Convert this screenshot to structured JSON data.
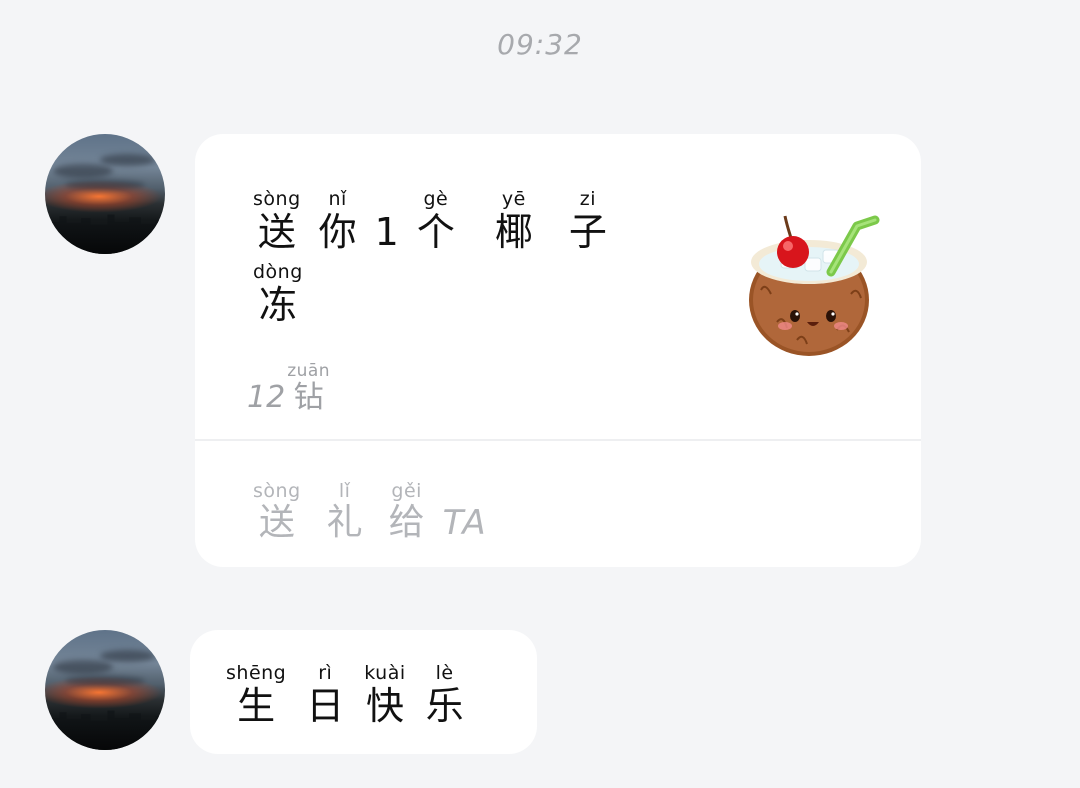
{
  "timestamp": "09:32",
  "messages": [
    {
      "type": "gift",
      "avatar_icon": "sunset-city-avatar",
      "gift_text_line1": [
        {
          "pinyin": "sòng",
          "hanzi": "送"
        },
        {
          "pinyin": "nǐ",
          "hanzi": "你"
        },
        {
          "pinyin": "",
          "hanzi": "1"
        },
        {
          "pinyin": "gè",
          "hanzi": "个"
        },
        {
          "pinyin": "yē",
          "hanzi": "椰"
        },
        {
          "pinyin": "zi",
          "hanzi": "子"
        }
      ],
      "gift_text_line2": [
        {
          "pinyin": "dòng",
          "hanzi": "冻"
        }
      ],
      "price": {
        "amount": "12",
        "unit_pinyin": "zuān",
        "unit_hanzi": "钻"
      },
      "gift_icon": "coconut-drink-icon",
      "send_action": {
        "words": [
          {
            "pinyin": "sòng",
            "hanzi": "送"
          },
          {
            "pinyin": "lǐ",
            "hanzi": "礼"
          },
          {
            "pinyin": "gěi",
            "hanzi": "给"
          }
        ],
        "suffix": "TA"
      }
    },
    {
      "type": "text",
      "avatar_icon": "sunset-city-avatar",
      "words": [
        {
          "pinyin": "shēng",
          "hanzi": "生"
        },
        {
          "pinyin": "rì",
          "hanzi": "日"
        },
        {
          "pinyin": "kuài",
          "hanzi": "快"
        },
        {
          "pinyin": "lè",
          "hanzi": "乐"
        }
      ]
    }
  ]
}
